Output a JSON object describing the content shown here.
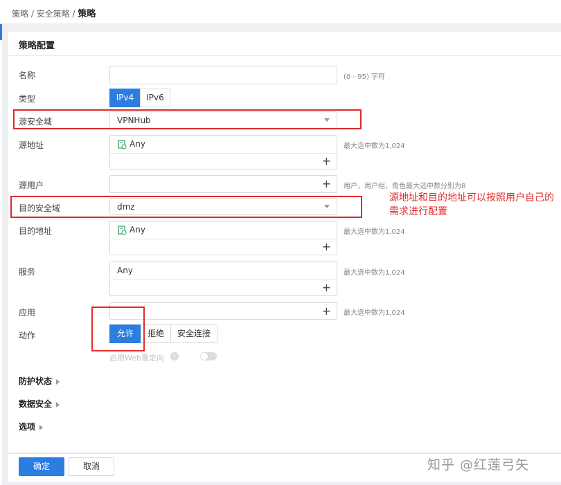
{
  "breadcrumb": {
    "part1": "策略 / 安全策略 / ",
    "current": "策略"
  },
  "card_title": "策略配置",
  "fields": {
    "name": {
      "label": "名称",
      "value": "",
      "hint": "(0 - 95) 字符"
    },
    "type": {
      "label": "类型",
      "options": [
        "IPv4",
        "IPv6"
      ],
      "selected": "IPv4"
    },
    "src_zone": {
      "label": "源安全域",
      "value": "VPNHub"
    },
    "src_addr": {
      "label": "源地址",
      "value": "Any",
      "hint": "最大选中数为1,024"
    },
    "src_user": {
      "label": "源用户",
      "hint": "用户，用户组，角色最大选中数分别为8"
    },
    "dst_zone": {
      "label": "目的安全域",
      "value": "dmz"
    },
    "dst_addr": {
      "label": "目的地址",
      "value": "Any",
      "hint": "最大选中数为1,024"
    },
    "service": {
      "label": "服务",
      "value": "Any",
      "hint": "最大选中数为1,024"
    },
    "app": {
      "label": "应用",
      "hint": "最大选中数为1,024"
    },
    "action": {
      "label": "动作",
      "options": [
        "允许",
        "拒绝",
        "安全连接"
      ],
      "selected": "允许"
    },
    "web_redirect": {
      "label": "启用Web重定向",
      "enabled": false
    }
  },
  "sections": [
    "防护状态",
    "数据安全",
    "选项"
  ],
  "buttons": {
    "ok": "确定",
    "cancel": "取消"
  },
  "annotation": "源地址和目的地址可以按照用户自己的需求进行配置",
  "watermark": "知乎 @红莲弓矢",
  "colors": {
    "primary": "#2b7de1",
    "annotation_red": "#e02b2b"
  }
}
